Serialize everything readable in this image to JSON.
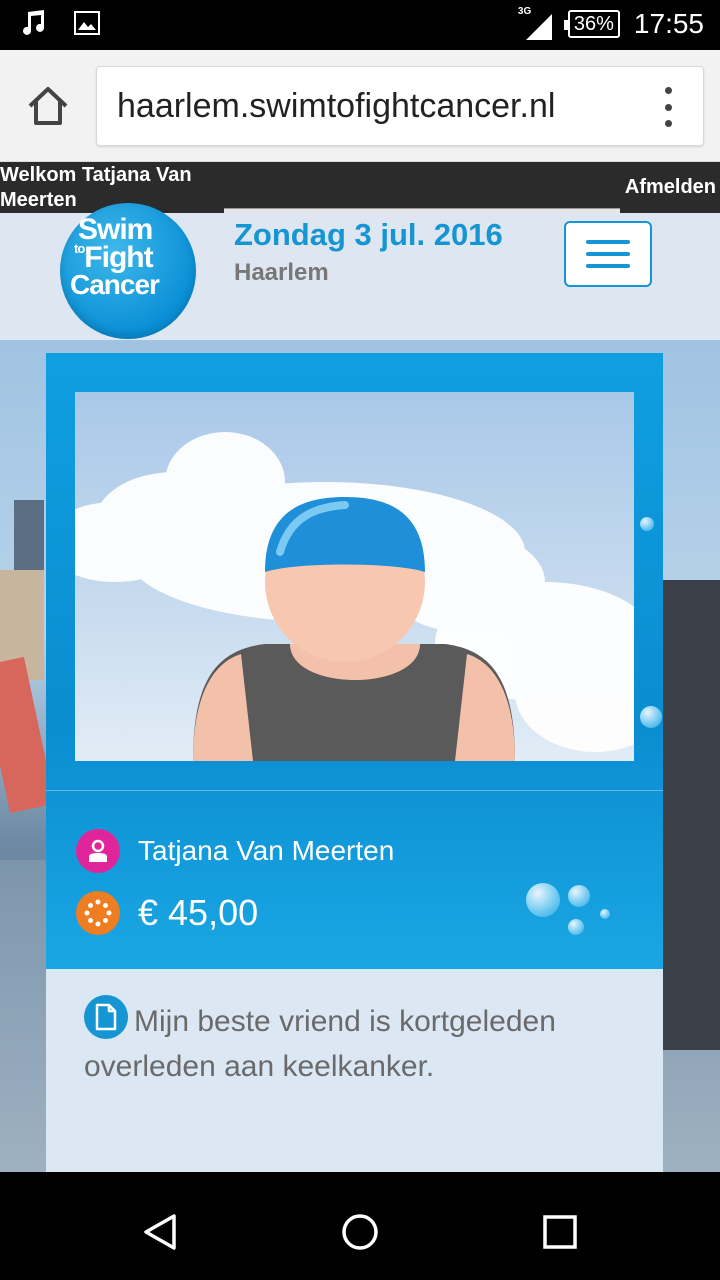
{
  "status_bar": {
    "network": "3G",
    "battery": "36%",
    "time": "17:55"
  },
  "browser": {
    "url": "haarlem.swimtofightcancer.nl"
  },
  "top_bar": {
    "welcome": "Welkom Tatjana Van Meerten",
    "logout": "Afmelden"
  },
  "header": {
    "logo": {
      "line1": "Swim",
      "line2_small": "to",
      "line2": "Fight",
      "line3": "Cancer"
    },
    "date": "Zondag 3 jul. 2016",
    "city": "Haarlem"
  },
  "profile": {
    "name": "Tatjana Van Meerten",
    "amount": "€ 45,00",
    "story": "Mijn beste vriend is kortgeleden overleden aan keelkanker."
  },
  "colors": {
    "brand_blue": "#1596d3",
    "user_icon_pink": "#e0259a",
    "amount_icon_orange": "#ef7d22"
  }
}
